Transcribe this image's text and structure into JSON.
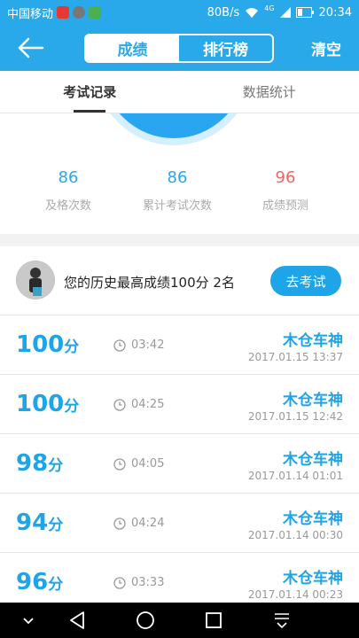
{
  "status_bar": {
    "carrier": "中国移动",
    "speed": "80B/s",
    "network": "4G",
    "time": "20:34"
  },
  "header": {
    "segments": [
      "成绩",
      "排行榜"
    ],
    "clear_label": "清空"
  },
  "tabs": [
    "考试记录",
    "数据统计"
  ],
  "stats": [
    {
      "value": "86",
      "label": "及格次数",
      "color": "#2aa5ef"
    },
    {
      "value": "86",
      "label": "累计考试次数",
      "color": "#2aa5ef"
    },
    {
      "value": "96",
      "label": "成绩预测",
      "color": "#f06464"
    }
  ],
  "best": {
    "text": "您的历史最高成绩100分  2名",
    "button": "去考试"
  },
  "records": [
    {
      "score": "100",
      "unit": "分",
      "duration": "03:42",
      "name": "木仓车神",
      "date": "2017.01.15  13:37"
    },
    {
      "score": "100",
      "unit": "分",
      "duration": "04:25",
      "name": "木仓车神",
      "date": "2017.01.15  12:42"
    },
    {
      "score": "98",
      "unit": "分",
      "duration": "04:05",
      "name": "木仓车神",
      "date": "2017.01.14  01:01"
    },
    {
      "score": "94",
      "unit": "分",
      "duration": "04:24",
      "name": "木仓车神",
      "date": "2017.01.14  00:30"
    },
    {
      "score": "96",
      "unit": "分",
      "duration": "03:33",
      "name": "木仓车神",
      "date": "2017.01.14  00:23"
    }
  ],
  "colors": {
    "accent": "#29a9ea",
    "fail": "#f06464"
  }
}
